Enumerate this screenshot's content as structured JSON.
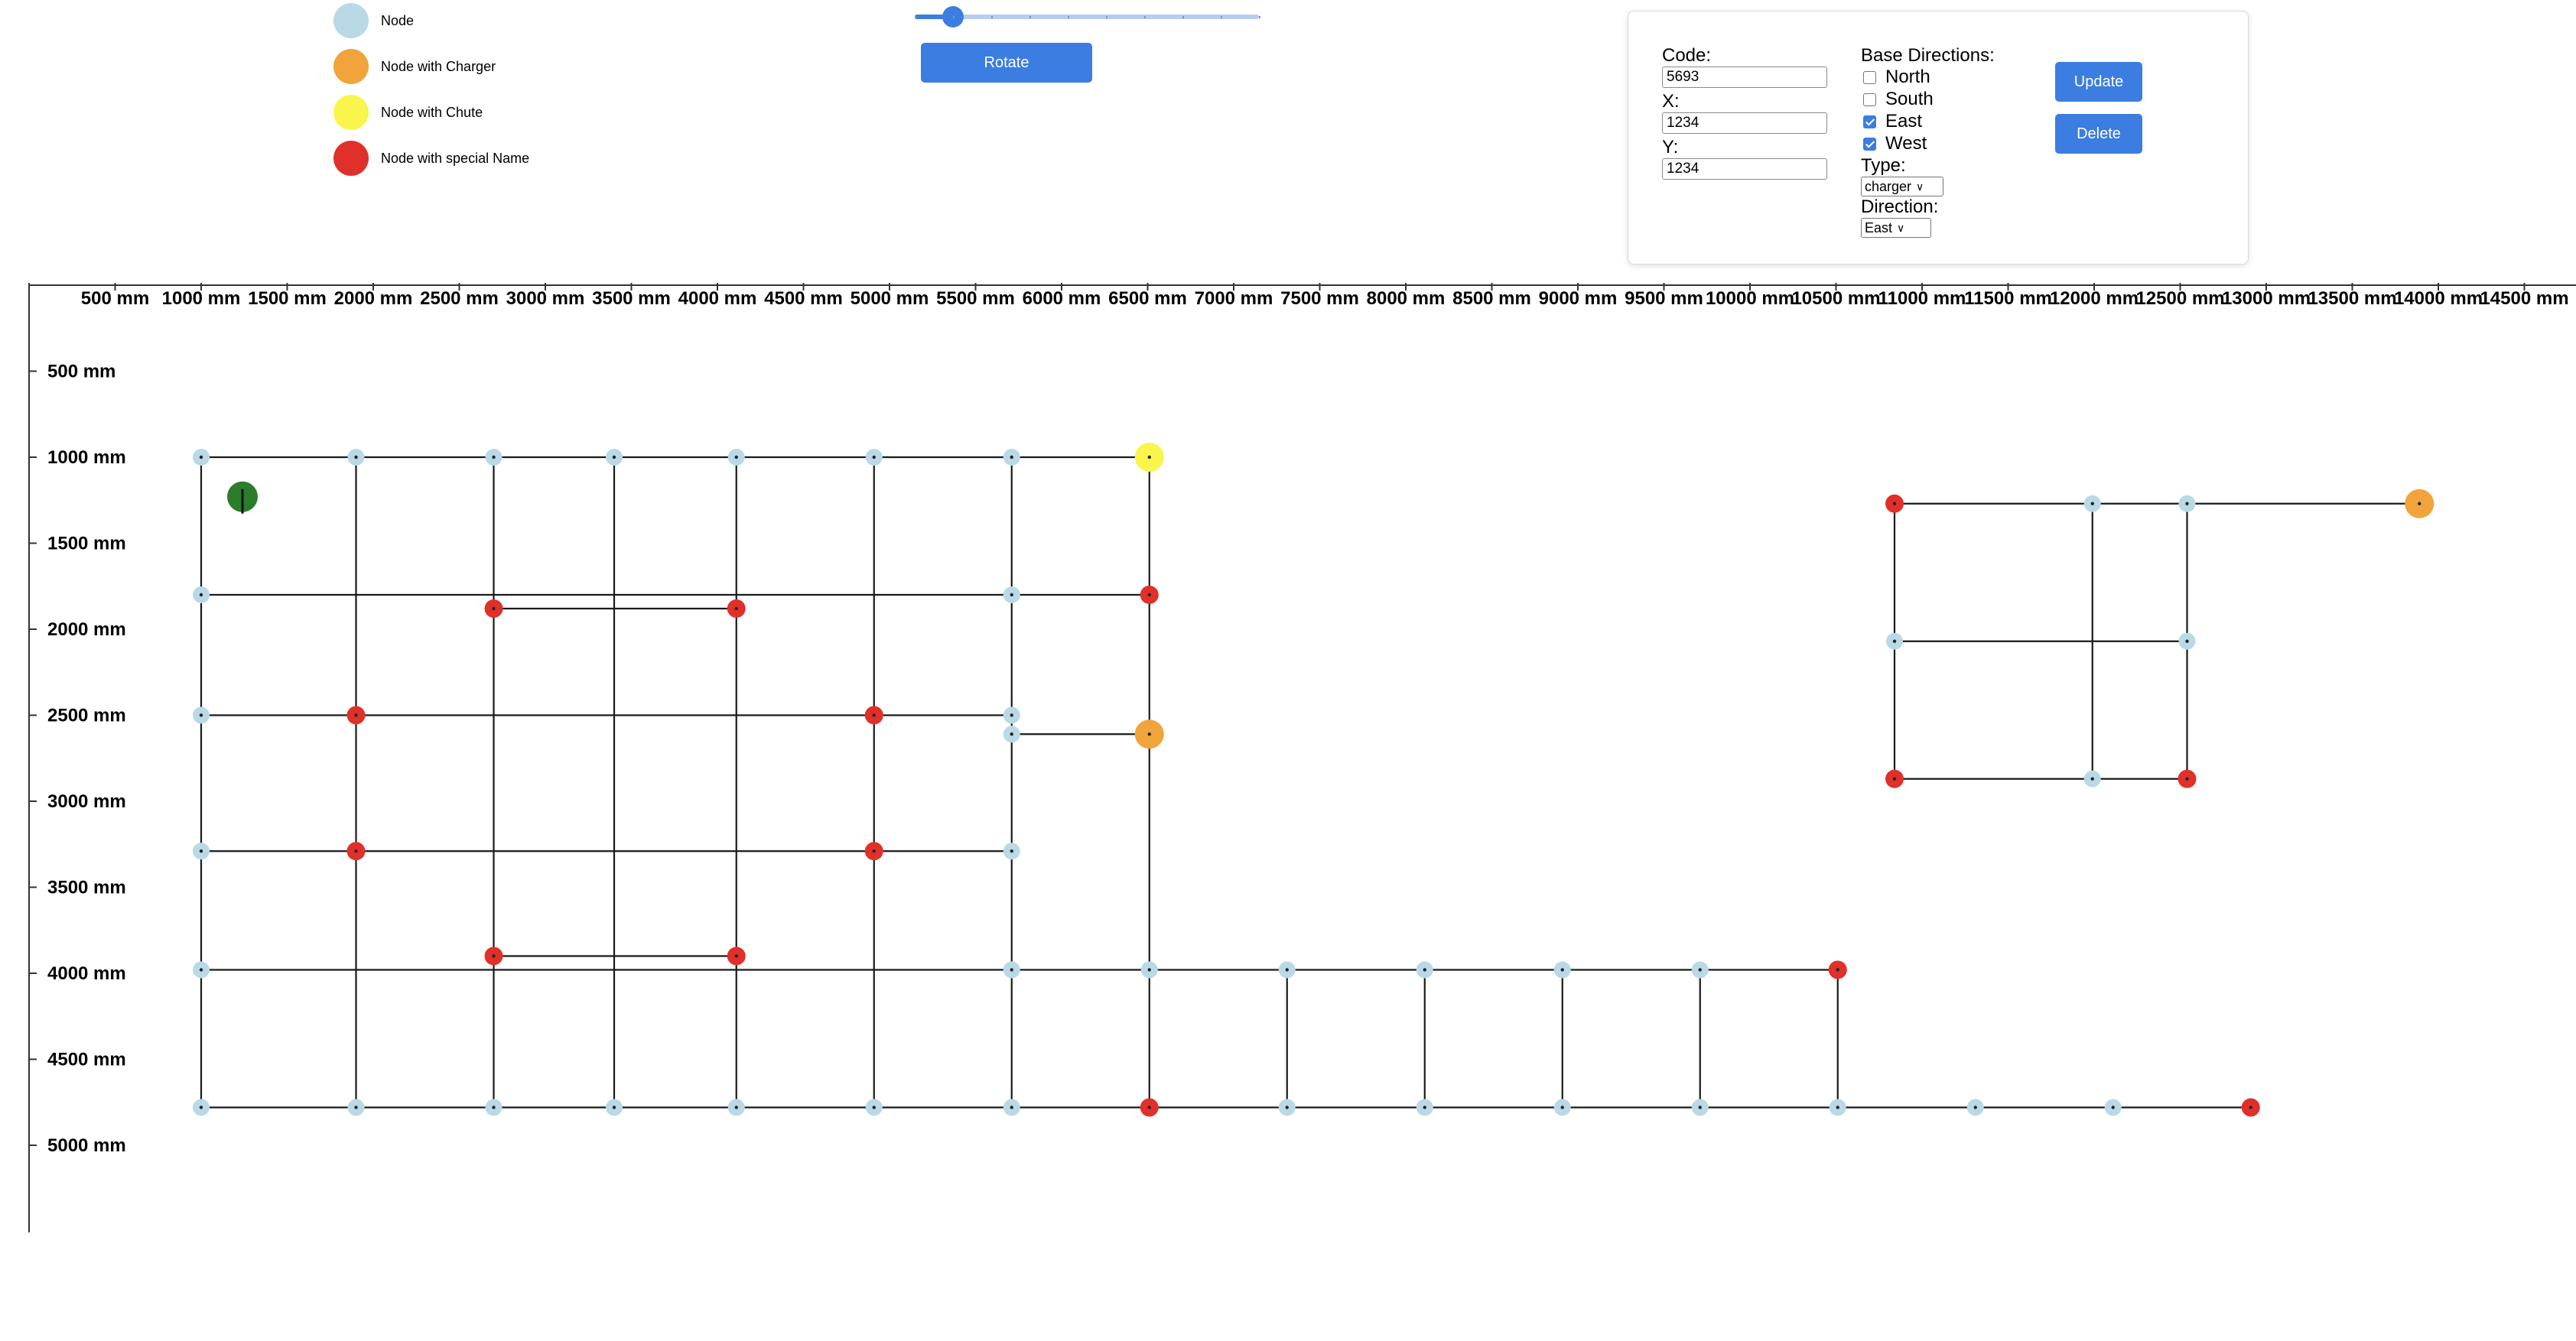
{
  "legend": [
    {
      "label": "Node",
      "color": "#b9d9e6"
    },
    {
      "label": "Node with Charger",
      "color": "#f1a43c"
    },
    {
      "label": "Node with Chute",
      "color": "#f9f54c"
    },
    {
      "label": "Node with special Name",
      "color": "#e0302a"
    }
  ],
  "rotate_slider": {
    "value_fraction": 0.11,
    "ticks": 10
  },
  "rotate_button": "Rotate",
  "editor": {
    "code_label": "Code:",
    "code_value": "5693",
    "x_label": "X:",
    "x_value": "1234",
    "y_label": "Y:",
    "y_value": "1234",
    "base_directions_label": "Base Directions:",
    "directions": [
      {
        "label": "North",
        "checked": false
      },
      {
        "label": "South",
        "checked": false
      },
      {
        "label": "East",
        "checked": true
      },
      {
        "label": "West",
        "checked": true
      }
    ],
    "type_label": "Type:",
    "type_value": "charger",
    "direction_label": "Direction:",
    "direction_value": "East",
    "update_button": "Update",
    "delete_button": "Delete"
  },
  "map": {
    "x_ticks": [
      "500 mm",
      "1000 mm",
      "1500 mm",
      "2000 mm",
      "2500 mm",
      "3000 mm",
      "3500 mm",
      "4000 mm",
      "4500 mm",
      "5000 mm",
      "5500 mm",
      "6000 mm",
      "6500 mm",
      "7000 mm",
      "7500 mm",
      "8000 mm",
      "8500 mm",
      "9000 mm",
      "9500 mm",
      "10000 mm",
      "10500 mm",
      "11000 mm",
      "11500 mm",
      "12000 mm",
      "12500 mm",
      "13000 mm",
      "13500 mm",
      "14000 mm",
      "14500 mm"
    ],
    "y_ticks": [
      "500 mm",
      "1000 mm",
      "1500 mm",
      "2000 mm",
      "2500 mm",
      "3000 mm",
      "3500 mm",
      "4000 mm",
      "4500 mm",
      "5000 mm"
    ],
    "colors": {
      "node": "#b9d9e6",
      "charger": "#f1a43c",
      "chute": "#f9f54c",
      "special": "#e0302a",
      "robot": "#2b7d2b",
      "edge": "#1a1a1a"
    }
  }
}
